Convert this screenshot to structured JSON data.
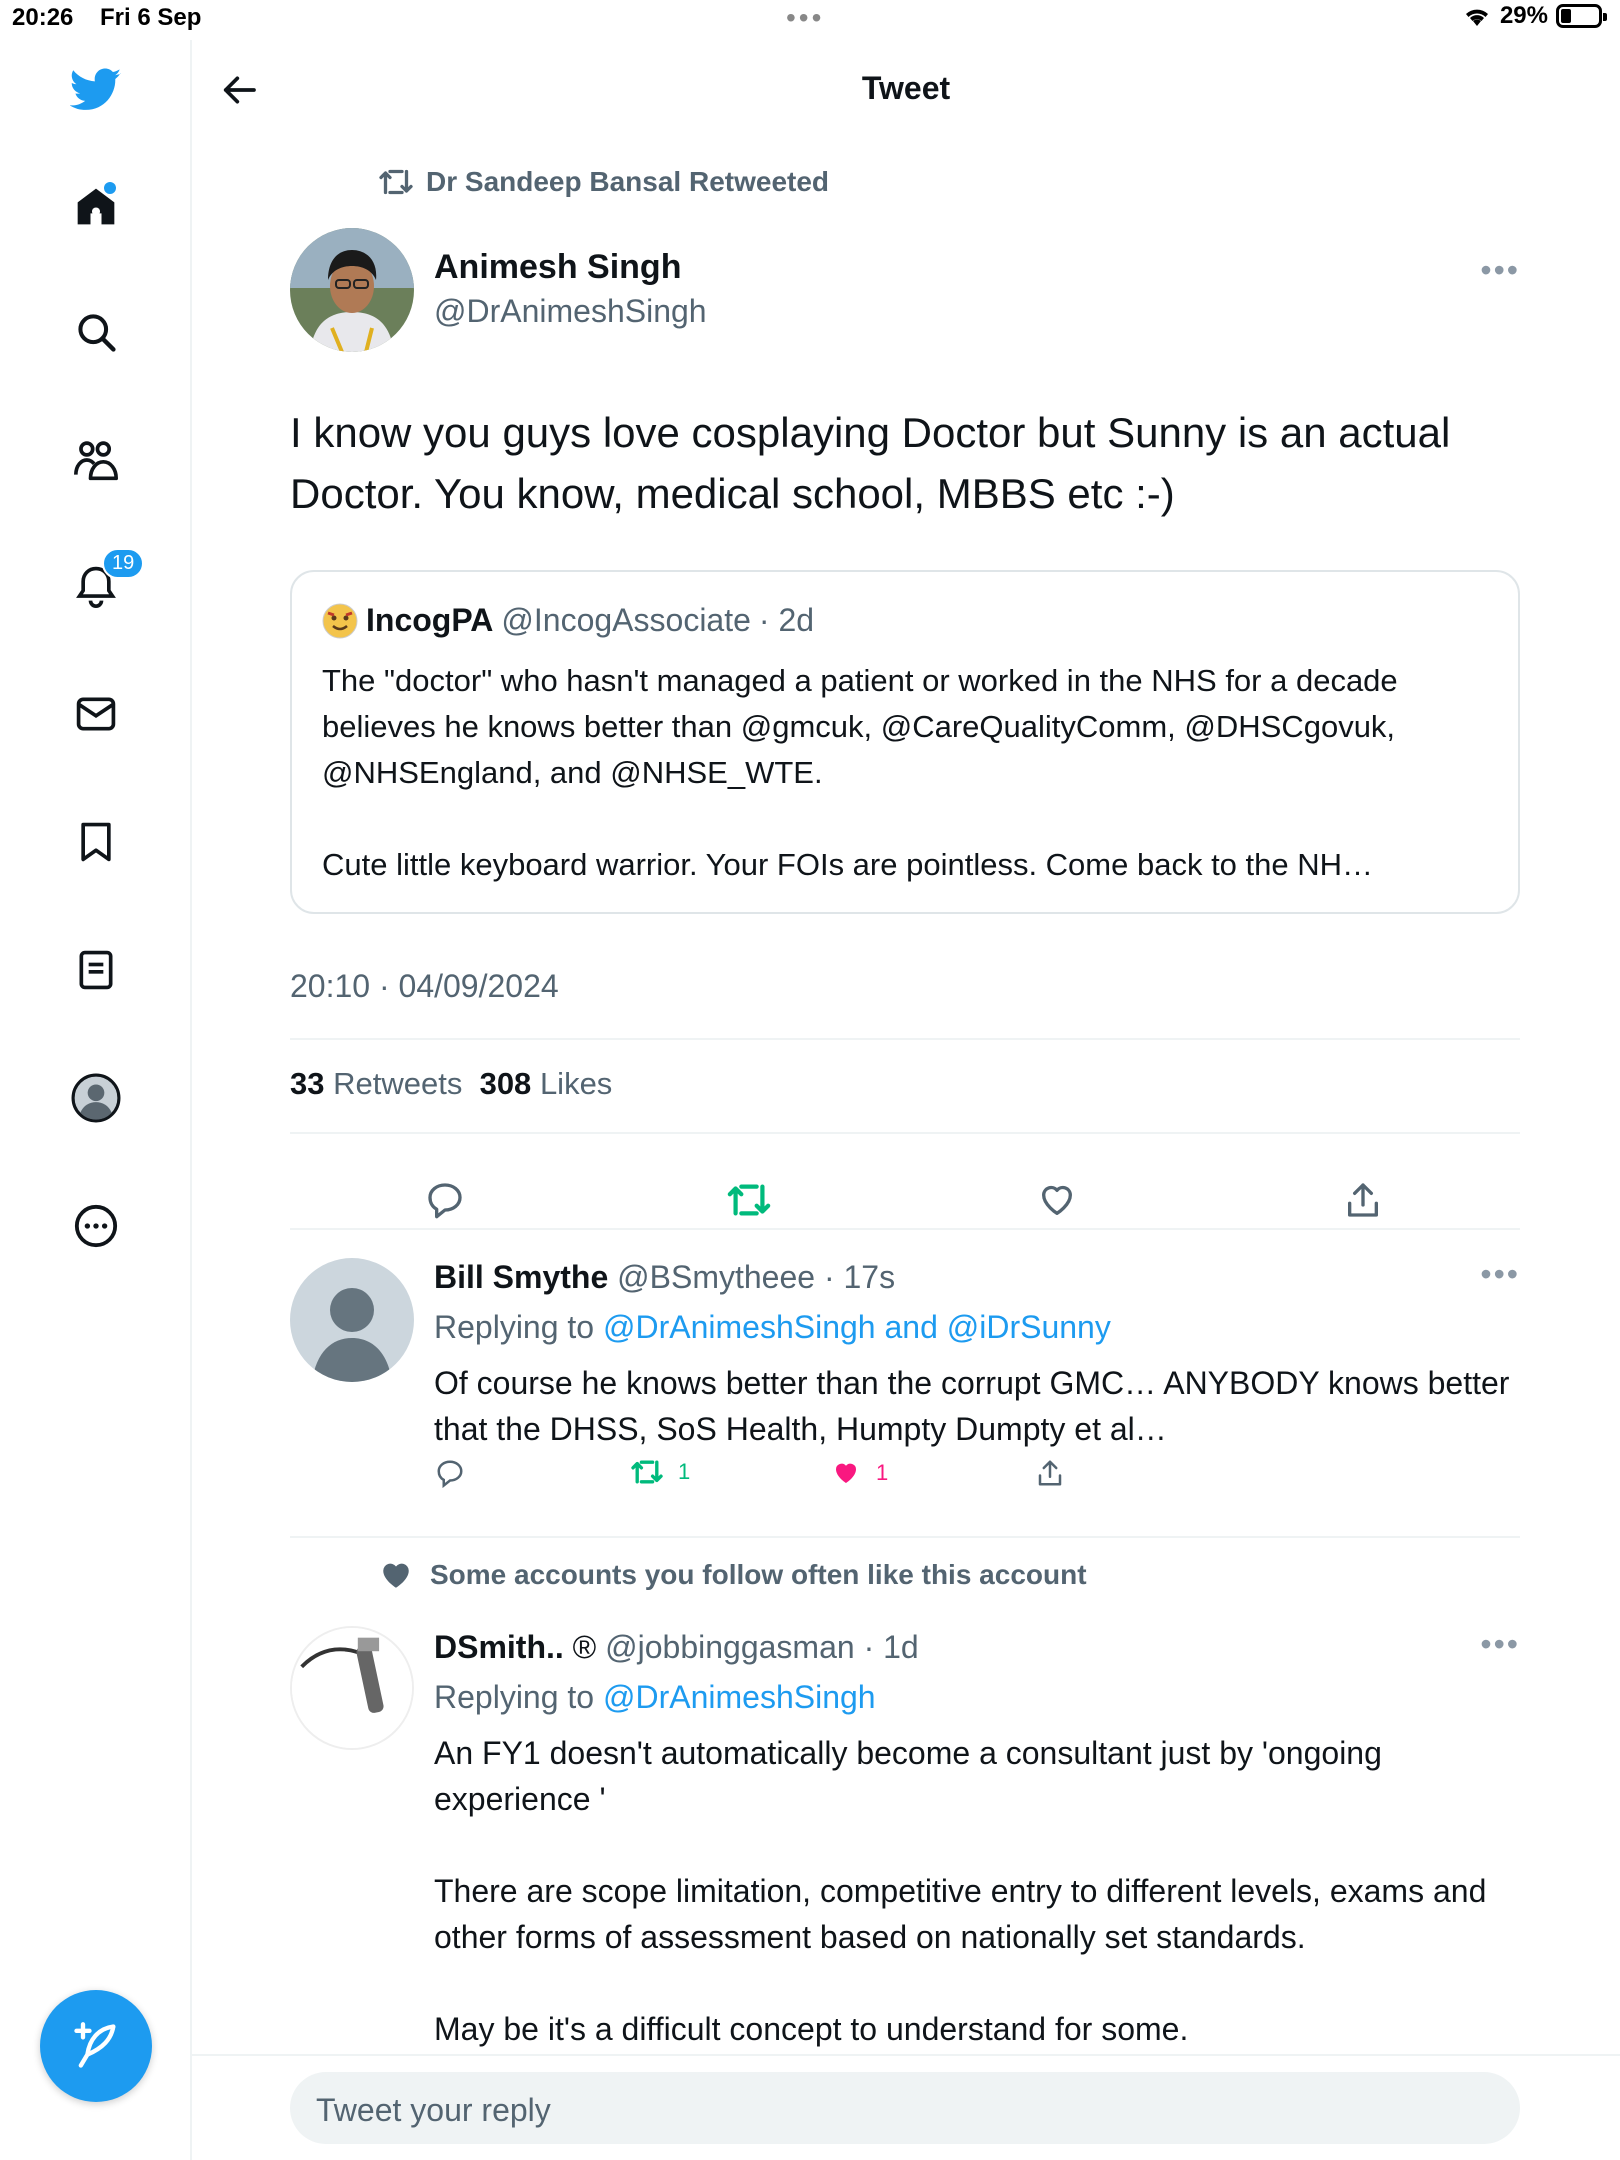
{
  "status": {
    "time": "20:26",
    "date": "Fri 6 Sep",
    "battery": "29%",
    "battery_level": 0.29
  },
  "sidebar": {
    "notifications_badge": "19"
  },
  "header": {
    "title": "Tweet"
  },
  "tweet": {
    "retweeted_by": "Dr Sandeep Bansal Retweeted",
    "author_name": "Animesh Singh",
    "author_handle": "@DrAnimeshSingh",
    "text": "I know you guys love cosplaying Doctor but Sunny is an actual Doctor. You know, medical school, MBBS etc :-)",
    "quote": {
      "name": "IncogPA",
      "handle": "@IncogAssociate",
      "age": "· 2d",
      "text": "The \"doctor\" who hasn't managed a patient or worked in the NHS for a decade believes he knows better than @gmcuk, @CareQualityComm, @DHSCgovuk, @NHSEngland, and @NHSE_WTE.\n\nCute little keyboard warrior. Your FOIs are pointless. Come back to the NH…"
    },
    "timestamp": "20:10 · 04/09/2024",
    "retweets_count": "33",
    "retweets_label": "Retweets",
    "likes_count": "308",
    "likes_label": "Likes"
  },
  "replies": [
    {
      "name": "Bill Smythe",
      "handle": "@BSmytheee",
      "age": "· 17s",
      "replying_prefix": "Replying to",
      "replying_to": "@DrAnimeshSingh and @iDrSunny",
      "text": "Of course he knows better than the corrupt GMC… ANYBODY knows better that the DHSS, SoS Health, Humpty Dumpty et al…",
      "retweets": "1",
      "likes": "1"
    },
    {
      "social_context": "Some accounts you follow often like this account",
      "name": "DSmith..",
      "badge": "®",
      "handle": "@jobbinggasman",
      "age": "· 1d",
      "replying_prefix": "Replying to",
      "replying_to": "@DrAnimeshSingh",
      "text": "An FY1 doesn't automatically become a consultant just by 'ongoing experience '\n\nThere are scope limitation, competitive entry to different levels, exams and other forms of assessment based on nationally set standards.\n\nMay be it's a difficult concept to understand for some."
    }
  ],
  "reply_bar": {
    "placeholder": "Tweet your reply"
  },
  "colors": {
    "accent": "#1d9bf0",
    "retweet": "#00ba7c",
    "like": "#f91880",
    "muted": "#536471"
  }
}
